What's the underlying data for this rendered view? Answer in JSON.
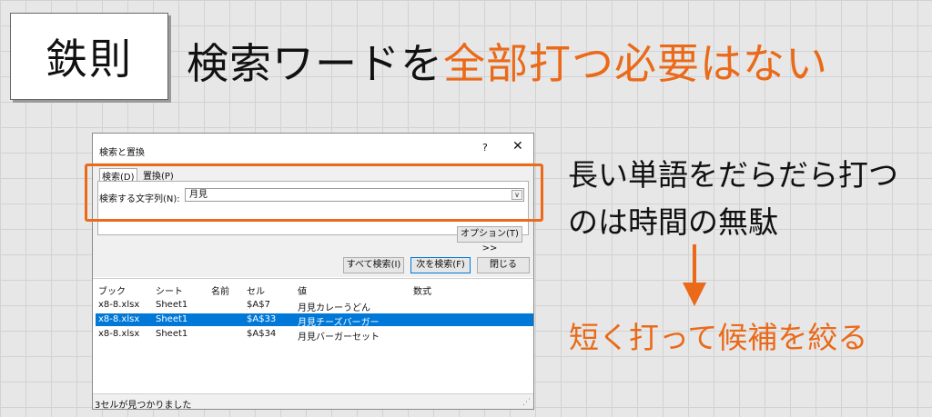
{
  "slide": {
    "tag": "鉄則",
    "headline": {
      "prefix": "検索ワードを",
      "highlight": "全部打つ必要はない"
    },
    "note": {
      "line1": "長い単語をだらだら打つ",
      "line2": "のは時間の無駄"
    },
    "conclusion": "短く打って候補を絞る",
    "colors": {
      "accent": "#ea6a19",
      "selection": "#0078d7"
    }
  },
  "dialog": {
    "title": "検索と置換",
    "help": "?",
    "close_icon": "✕",
    "tabs": [
      {
        "label": "検索(D)"
      },
      {
        "label": "置換(P)"
      }
    ],
    "find_label": "検索する文字列(N):",
    "find_value": "月見",
    "dropdown_icon": "∨",
    "buttons": {
      "options": "オプション(T) >>",
      "find_all": "すべて検索(I)",
      "find_next": "次を検索(F)",
      "close": "閉じる"
    },
    "results": {
      "columns": [
        "ブック",
        "シート",
        "名前",
        "セル",
        "値",
        "数式"
      ],
      "rows": [
        {
          "book": "x8-8.xlsx",
          "sheet": "Sheet1",
          "name": "",
          "cell": "$A$7",
          "value": "月見カレーうどん",
          "formula": ""
        },
        {
          "book": "x8-8.xlsx",
          "sheet": "Sheet1",
          "name": "",
          "cell": "$A$33",
          "value": "月見チーズバーガー",
          "formula": ""
        },
        {
          "book": "x8-8.xlsx",
          "sheet": "Sheet1",
          "name": "",
          "cell": "$A$34",
          "value": "月見バーガーセット",
          "formula": ""
        }
      ],
      "selected_row": 2
    },
    "status": "3セルが見つかりました",
    "grip_icon": "⋰"
  }
}
